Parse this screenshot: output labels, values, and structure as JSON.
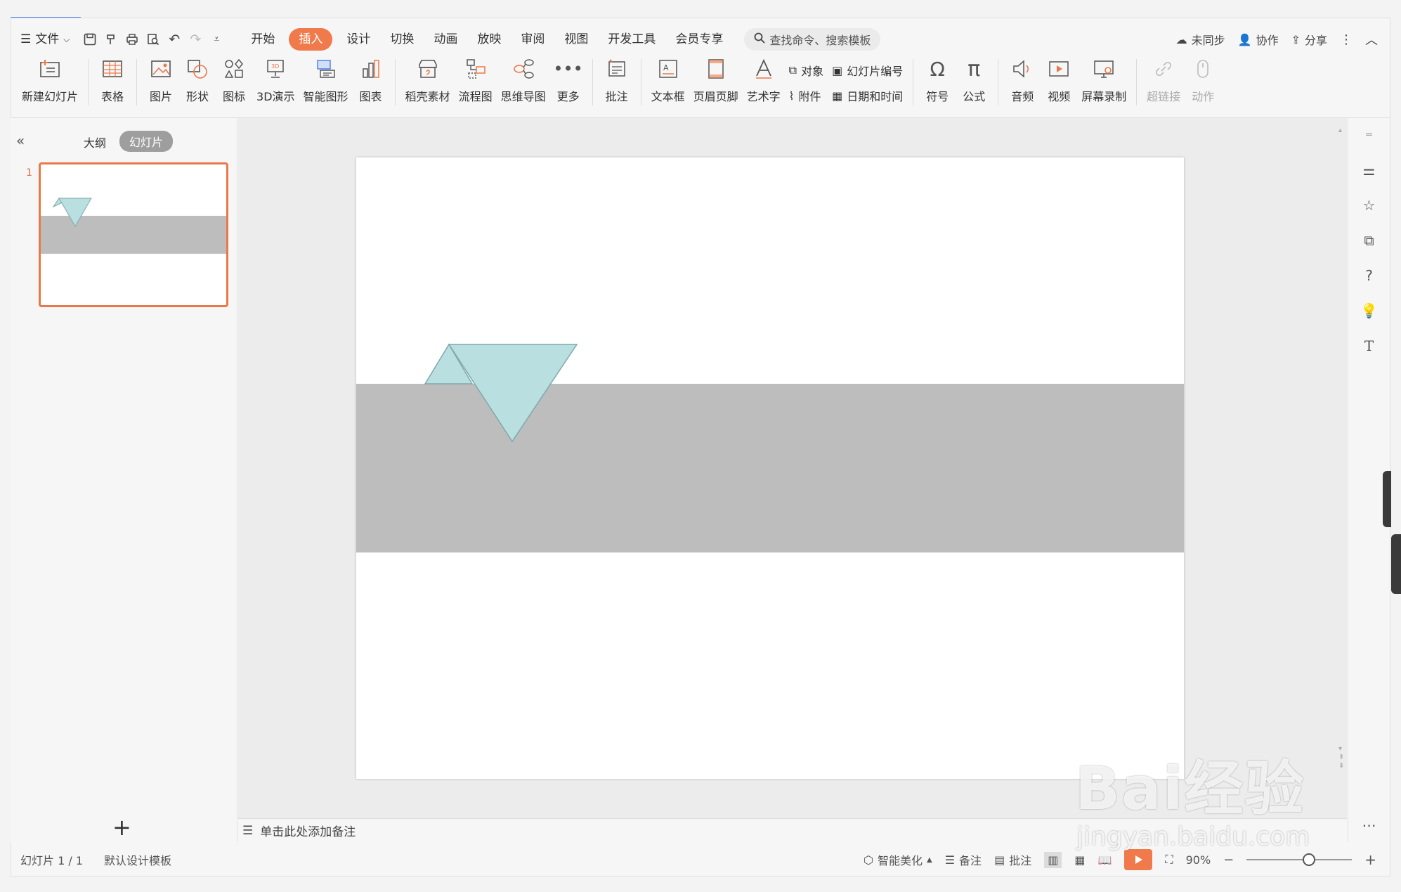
{
  "menu": {
    "file": "文件",
    "tabs": [
      "开始",
      "插入",
      "设计",
      "切换",
      "动画",
      "放映",
      "审阅",
      "视图",
      "开发工具",
      "会员专享"
    ],
    "active_tab": "插入",
    "search_placeholder": "查找命令、搜索模板",
    "sync": "未同步",
    "collaborate": "协作",
    "share": "分享"
  },
  "ribbon": {
    "new_slide": "新建幻灯片",
    "table": "表格",
    "picture": "图片",
    "shape": "形状",
    "icon": "图标",
    "demo3d": "3D演示",
    "smartart": "智能图形",
    "chart": "图表",
    "material": "稻壳素材",
    "flowchart": "流程图",
    "mindmap": "思维导图",
    "more": "更多",
    "comment": "批注",
    "textbox": "文本框",
    "header_footer": "页眉页脚",
    "wordart": "艺术字",
    "object": "对象",
    "attachment": "附件",
    "slide_number": "幻灯片编号",
    "datetime": "日期和时间",
    "symbol": "符号",
    "formula": "公式",
    "audio": "音频",
    "video": "视频",
    "screen_record": "屏幕录制",
    "hyperlink": "超链接",
    "action": "动作"
  },
  "left_panel": {
    "outline_tab": "大纲",
    "slides_tab": "幻灯片",
    "slide_number": "1",
    "add_label": "+"
  },
  "notes": {
    "placeholder": "单击此处添加备注"
  },
  "status": {
    "slide_info": "幻灯片 1 / 1",
    "template": "默认设计模板",
    "beautify": "智能美化",
    "notes": "备注",
    "comments": "批注",
    "zoom": "90%"
  },
  "watermark": {
    "main": "Bai经验",
    "sub": "jingyan.baidu.com"
  },
  "colors": {
    "accent": "#f07a4b",
    "band": "#bdbdbd",
    "triangle_fill": "#b9dfe0",
    "triangle_stroke": "#7fa9ab"
  }
}
